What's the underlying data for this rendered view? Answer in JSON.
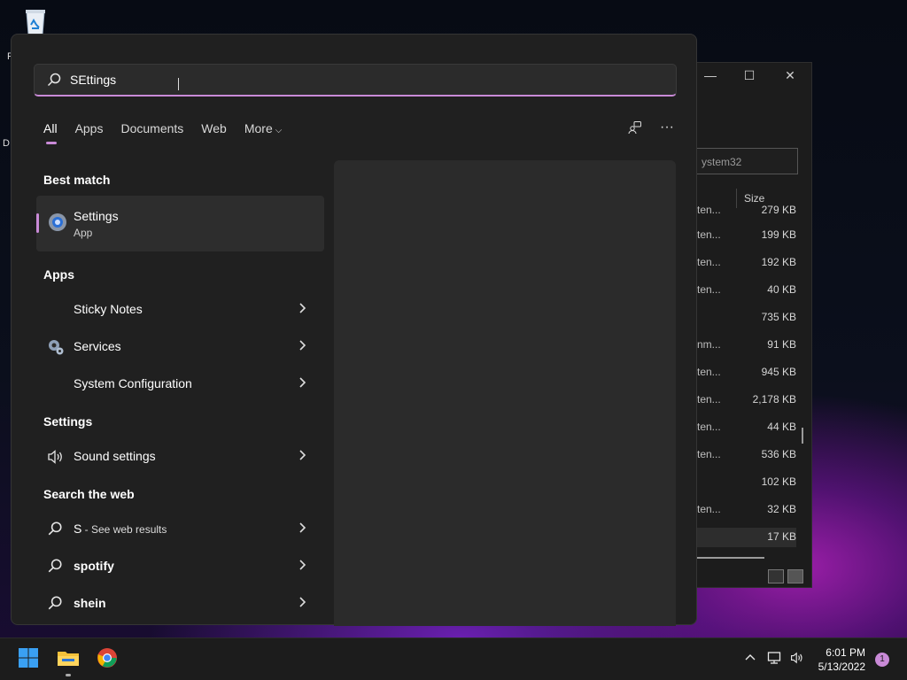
{
  "desktop": {
    "labels": [
      "R",
      "D"
    ]
  },
  "explorer": {
    "address_fragment": "ystem32",
    "column_header": "Size",
    "rows": [
      {
        "type": "ten...",
        "size": "279 KB"
      },
      {
        "type": "ten...",
        "size": "199 KB"
      },
      {
        "type": "ten...",
        "size": "192 KB"
      },
      {
        "type": "ten...",
        "size": "40 KB"
      },
      {
        "type": "",
        "size": "735 KB"
      },
      {
        "type": "nm...",
        "size": "91 KB"
      },
      {
        "type": "ten...",
        "size": "945 KB"
      },
      {
        "type": "ten...",
        "size": "2,178 KB"
      },
      {
        "type": "ten...",
        "size": "44 KB"
      },
      {
        "type": "ten...",
        "size": "536 KB"
      },
      {
        "type": "",
        "size": "102 KB"
      },
      {
        "type": "ten...",
        "size": "32 KB"
      },
      {
        "type": "",
        "size": "17 KB"
      }
    ],
    "buttons": {
      "minimize": "—",
      "maximize": "☐",
      "close": "✕"
    }
  },
  "search": {
    "query": "SEttings"
  },
  "tabs": [
    {
      "label": "All"
    },
    {
      "label": "Apps"
    },
    {
      "label": "Documents"
    },
    {
      "label": "Web"
    },
    {
      "label": "More"
    }
  ],
  "sections": {
    "best_match": "Best match",
    "apps": "Apps",
    "settings": "Settings",
    "search_web": "Search the web"
  },
  "best_match": {
    "title": "Settings",
    "subtitle": "App"
  },
  "apps": [
    {
      "label": "Sticky Notes",
      "icon": "sticky-notes-icon"
    },
    {
      "label": "Services",
      "icon": "services-gear-icon"
    },
    {
      "label": "System Configuration",
      "icon": "system-config-icon"
    }
  ],
  "settings_items": [
    {
      "label": "Sound settings",
      "icon": "speaker-icon"
    }
  ],
  "web_items": [
    {
      "label": "S",
      "suffix": " - See web results"
    },
    {
      "label": "spotify",
      "suffix": ""
    },
    {
      "label": "shein",
      "suffix": ""
    }
  ],
  "taskbar": {
    "time": "6:01 PM",
    "date": "5/13/2022",
    "notification_count": "1"
  },
  "colors": {
    "accent": "#c98ad7",
    "panel": "#202020",
    "preview": "#2b2b2b"
  }
}
